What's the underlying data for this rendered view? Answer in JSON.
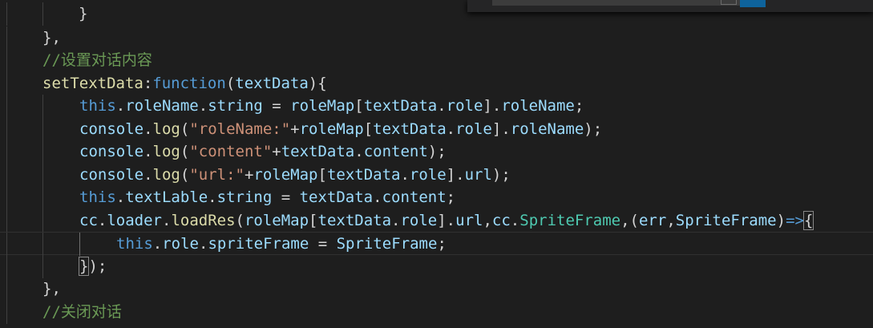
{
  "colors": {
    "background": "#1e1e1e",
    "default": "#d4d4d4",
    "keyword": "#569cd6",
    "function": "#dcdcaa",
    "property": "#9cdcfe",
    "string": "#ce9178",
    "comment": "#6a9955",
    "class": "#4ec9b0",
    "guide": "#404040"
  },
  "editor": {
    "lines": [
      [
        {
          "t": "default",
          "v": "}"
        }
      ],
      [
        {
          "t": "default",
          "v": "},"
        }
      ],
      [
        {
          "t": "comment",
          "v": "//设置对话内容"
        }
      ],
      [
        {
          "t": "function",
          "v": "setTextData"
        },
        {
          "t": "default",
          "v": ":"
        },
        {
          "t": "keyword",
          "v": "function"
        },
        {
          "t": "default",
          "v": "("
        },
        {
          "t": "property",
          "v": "textData"
        },
        {
          "t": "default",
          "v": "){"
        }
      ],
      [
        {
          "t": "keyword",
          "v": "this"
        },
        {
          "t": "default",
          "v": "."
        },
        {
          "t": "property",
          "v": "roleName"
        },
        {
          "t": "default",
          "v": "."
        },
        {
          "t": "property",
          "v": "string"
        },
        {
          "t": "default",
          "v": " = "
        },
        {
          "t": "property",
          "v": "roleMap"
        },
        {
          "t": "default",
          "v": "["
        },
        {
          "t": "property",
          "v": "textData"
        },
        {
          "t": "default",
          "v": "."
        },
        {
          "t": "property",
          "v": "role"
        },
        {
          "t": "default",
          "v": "]."
        },
        {
          "t": "property",
          "v": "roleName"
        },
        {
          "t": "default",
          "v": ";"
        }
      ],
      [
        {
          "t": "property",
          "v": "console"
        },
        {
          "t": "default",
          "v": "."
        },
        {
          "t": "function",
          "v": "log"
        },
        {
          "t": "default",
          "v": "("
        },
        {
          "t": "string",
          "v": "\"roleName:\""
        },
        {
          "t": "default",
          "v": "+"
        },
        {
          "t": "property",
          "v": "roleMap"
        },
        {
          "t": "default",
          "v": "["
        },
        {
          "t": "property",
          "v": "textData"
        },
        {
          "t": "default",
          "v": "."
        },
        {
          "t": "property",
          "v": "role"
        },
        {
          "t": "default",
          "v": "]."
        },
        {
          "t": "property",
          "v": "roleName"
        },
        {
          "t": "default",
          "v": ");"
        }
      ],
      [
        {
          "t": "property",
          "v": "console"
        },
        {
          "t": "default",
          "v": "."
        },
        {
          "t": "function",
          "v": "log"
        },
        {
          "t": "default",
          "v": "("
        },
        {
          "t": "string",
          "v": "\"content\""
        },
        {
          "t": "default",
          "v": "+"
        },
        {
          "t": "property",
          "v": "textData"
        },
        {
          "t": "default",
          "v": "."
        },
        {
          "t": "property",
          "v": "content"
        },
        {
          "t": "default",
          "v": ");"
        }
      ],
      [
        {
          "t": "property",
          "v": "console"
        },
        {
          "t": "default",
          "v": "."
        },
        {
          "t": "function",
          "v": "log"
        },
        {
          "t": "default",
          "v": "("
        },
        {
          "t": "string",
          "v": "\"url:\""
        },
        {
          "t": "default",
          "v": "+"
        },
        {
          "t": "property",
          "v": "roleMap"
        },
        {
          "t": "default",
          "v": "["
        },
        {
          "t": "property",
          "v": "textData"
        },
        {
          "t": "default",
          "v": "."
        },
        {
          "t": "property",
          "v": "role"
        },
        {
          "t": "default",
          "v": "]."
        },
        {
          "t": "property",
          "v": "url"
        },
        {
          "t": "default",
          "v": ");"
        }
      ],
      [
        {
          "t": "keyword",
          "v": "this"
        },
        {
          "t": "default",
          "v": "."
        },
        {
          "t": "property",
          "v": "textLable"
        },
        {
          "t": "default",
          "v": "."
        },
        {
          "t": "property",
          "v": "string"
        },
        {
          "t": "default",
          "v": " = "
        },
        {
          "t": "property",
          "v": "textData"
        },
        {
          "t": "default",
          "v": "."
        },
        {
          "t": "property",
          "v": "content"
        },
        {
          "t": "default",
          "v": ";"
        }
      ],
      [
        {
          "t": "property",
          "v": "cc"
        },
        {
          "t": "default",
          "v": "."
        },
        {
          "t": "property",
          "v": "loader"
        },
        {
          "t": "default",
          "v": "."
        },
        {
          "t": "function",
          "v": "loadRes"
        },
        {
          "t": "default",
          "v": "("
        },
        {
          "t": "property",
          "v": "roleMap"
        },
        {
          "t": "default",
          "v": "["
        },
        {
          "t": "property",
          "v": "textData"
        },
        {
          "t": "default",
          "v": "."
        },
        {
          "t": "property",
          "v": "role"
        },
        {
          "t": "default",
          "v": "]."
        },
        {
          "t": "property",
          "v": "url"
        },
        {
          "t": "default",
          "v": ","
        },
        {
          "t": "property",
          "v": "cc"
        },
        {
          "t": "default",
          "v": "."
        },
        {
          "t": "class",
          "v": "SpriteFrame"
        },
        {
          "t": "default",
          "v": ",("
        },
        {
          "t": "property",
          "v": "err"
        },
        {
          "t": "default",
          "v": ","
        },
        {
          "t": "property",
          "v": "SpriteFrame"
        },
        {
          "t": "default",
          "v": ")"
        },
        {
          "t": "keyword",
          "v": "=>"
        },
        {
          "t": "default",
          "v": "{"
        }
      ],
      [
        {
          "t": "keyword",
          "v": "this"
        },
        {
          "t": "default",
          "v": "."
        },
        {
          "t": "property",
          "v": "role"
        },
        {
          "t": "default",
          "v": "."
        },
        {
          "t": "property",
          "v": "spriteFrame"
        },
        {
          "t": "default",
          "v": " = "
        },
        {
          "t": "property",
          "v": "SpriteFrame"
        },
        {
          "t": "default",
          "v": ";"
        }
      ],
      [
        {
          "t": "default",
          "v": "}"
        },
        {
          "t": "default",
          "v": ");"
        }
      ],
      [
        {
          "t": "default",
          "v": "},"
        }
      ],
      [
        {
          "t": "comment",
          "v": "//关闭对话"
        }
      ]
    ]
  }
}
